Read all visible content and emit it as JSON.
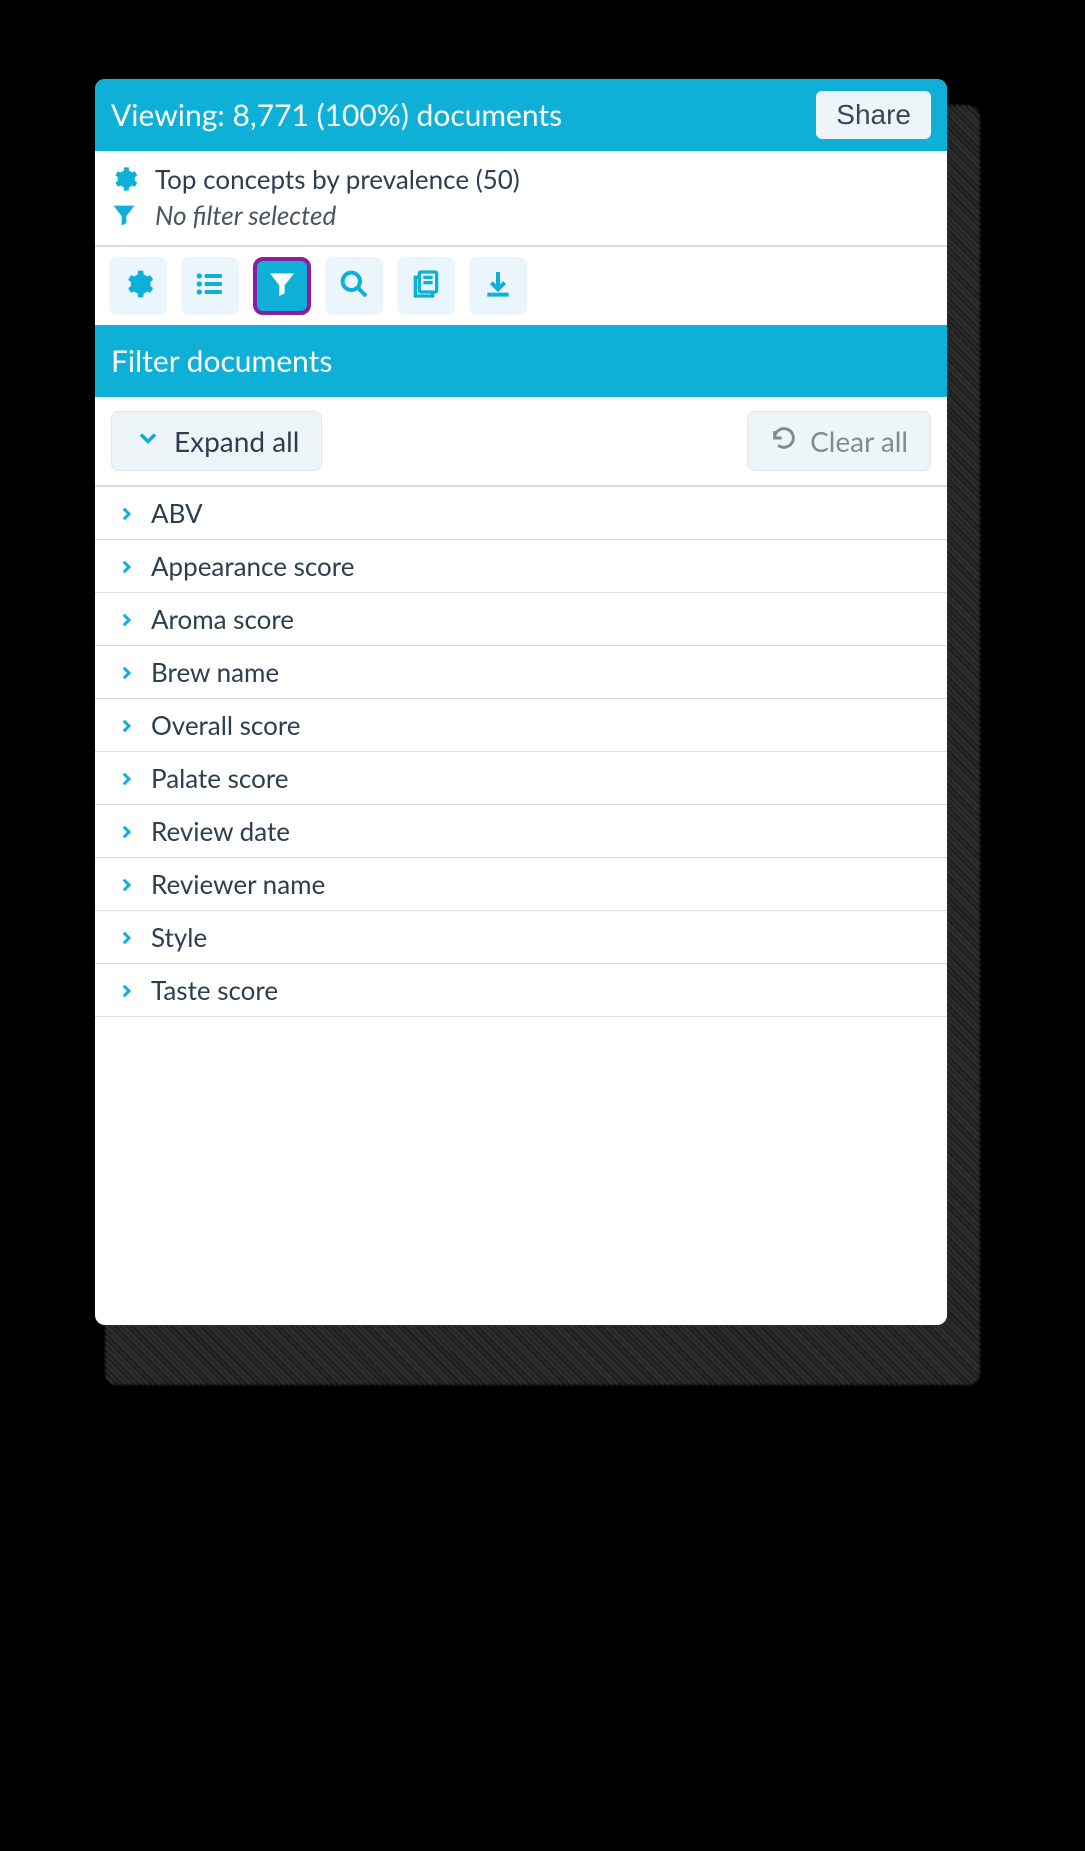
{
  "header": {
    "viewing_label": "Viewing: 8,771 (100%) documents",
    "share_label": "Share"
  },
  "summary": {
    "concept_line": "Top concepts by prevalence (50)",
    "filter_line": "No filter selected"
  },
  "toolbar": {
    "items": [
      {
        "name": "settings-button",
        "icon": "gear-icon"
      },
      {
        "name": "list-button",
        "icon": "list-icon"
      },
      {
        "name": "filter-button",
        "icon": "filter-icon",
        "active": true
      },
      {
        "name": "search-button",
        "icon": "search-icon"
      },
      {
        "name": "documents-button",
        "icon": "documents-icon"
      },
      {
        "name": "download-button",
        "icon": "download-icon"
      }
    ]
  },
  "section": {
    "title": "Filter documents",
    "expand_label": "Expand all",
    "clear_label": "Clear all"
  },
  "filters": [
    {
      "label": "ABV"
    },
    {
      "label": "Appearance score"
    },
    {
      "label": "Aroma score"
    },
    {
      "label": "Brew name"
    },
    {
      "label": "Overall score"
    },
    {
      "label": "Palate score"
    },
    {
      "label": "Review date"
    },
    {
      "label": "Reviewer name"
    },
    {
      "label": "Style"
    },
    {
      "label": "Taste score"
    }
  ]
}
